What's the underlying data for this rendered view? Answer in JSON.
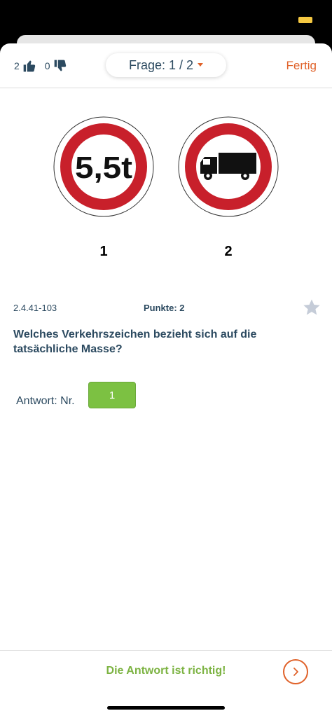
{
  "header": {
    "likes_count": "2",
    "dislikes_count": "0",
    "question_label": "Frage: 1 / 2",
    "done_label": "Fertig"
  },
  "signs": [
    {
      "number": "1",
      "text": "5,5t",
      "icon": "weight-limit-sign"
    },
    {
      "number": "2",
      "icon": "no-trucks-sign"
    }
  ],
  "question": {
    "id": "2.4.41-103",
    "points": "Punkte: 2",
    "text": "Welches Verkehrszeichen bezieht sich auf die tatsächliche Masse?"
  },
  "answer": {
    "label": "Antwort: Nr.",
    "value": "1"
  },
  "footer": {
    "result_text": "Die Antwort ist richtig!"
  },
  "colors": {
    "accent": "#e0622a",
    "text": "#2c4a60",
    "success": "#7cc142",
    "sign_red": "#c8202b"
  }
}
